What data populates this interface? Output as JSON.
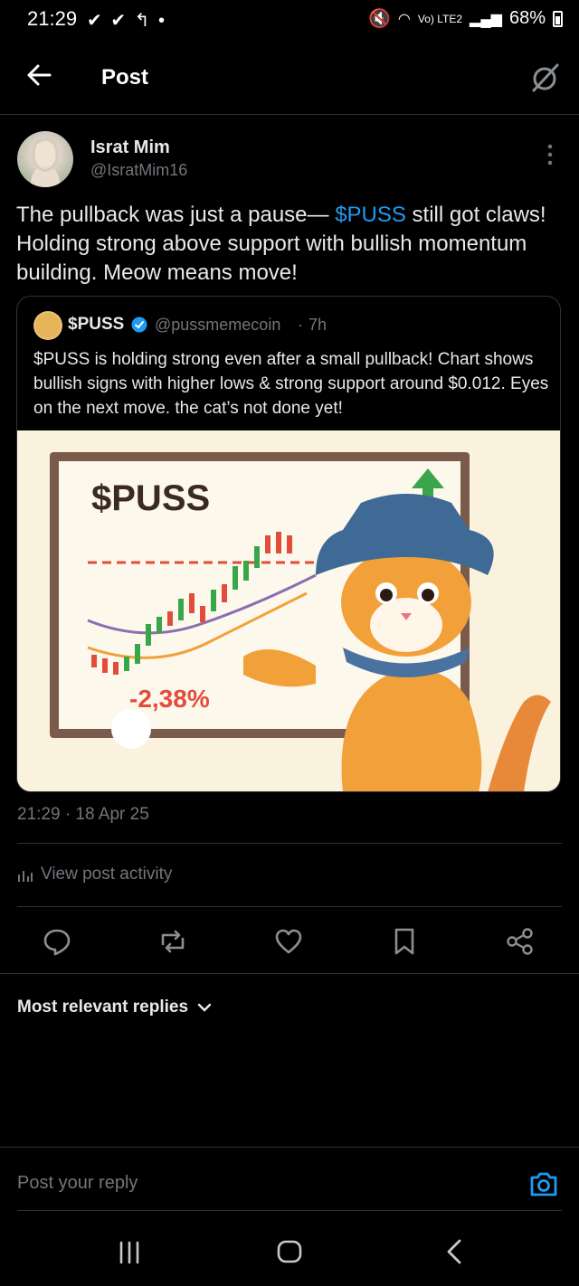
{
  "status_bar": {
    "time": "21:29",
    "left_icons": "✔ ✔ ↰ •",
    "network": "Vo) LTE2",
    "battery": "68%"
  },
  "header": {
    "title": "Post"
  },
  "post": {
    "author_name": "Israt Mim",
    "author_handle": "@IsratMim16",
    "text_before": "The pullback was just a pause— ",
    "text_link": "$PUSS",
    "text_after": " still got claws! Holding strong above support with bullish momentum building. Meow means move!",
    "timestamp": "21:29 · 18 Apr 25",
    "activity_label": "View post activity"
  },
  "quote": {
    "name": "$PUSS",
    "handle": "@pussmemecoin",
    "dot": "·",
    "time": "7h",
    "text": "$PUSS is holding strong even after a small pullback! Chart shows bullish signs with higher lows & strong support around $0.012. Eyes on the next move. the cat’s not done yet!",
    "image": {
      "board_title": "$PUSS",
      "change_label": "-2,38%"
    }
  },
  "replies": {
    "sort_label": "Most relevant replies"
  },
  "composer": {
    "placeholder": "Post your reply"
  },
  "colors": {
    "accent": "#1d9bf0",
    "muted": "#71767b",
    "divider": "#2f3336"
  }
}
